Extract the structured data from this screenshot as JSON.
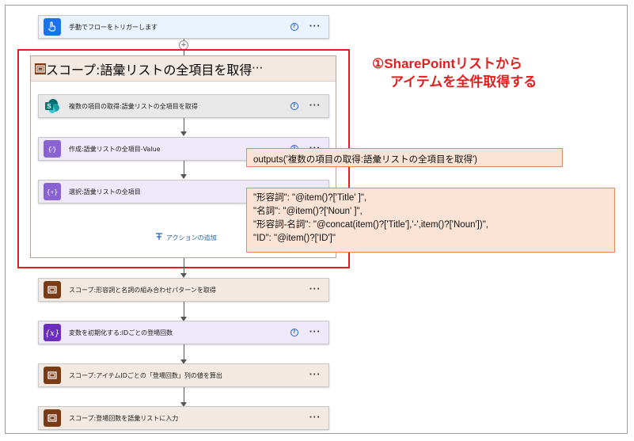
{
  "flow": {
    "trigger": {
      "label": "手動でフローをトリガーします",
      "icon": "hand-touch-icon",
      "color": "#1a73e8"
    },
    "scope_main": {
      "label": "スコープ:語彙リストの全項目を取得",
      "color": "#7a3b17"
    },
    "inner_steps": [
      {
        "label": "複数の項目の取得:語彙リストの全項目を取得",
        "icon": "sharepoint-icon",
        "color": "#038387"
      },
      {
        "label": "作成:語彙リストの全項目-Value",
        "icon": "data-operation-icon",
        "color": "#8a63d2"
      },
      {
        "label": "選択:語彙リストの全項目",
        "icon": "data-operation-icon",
        "color": "#8a63d2"
      }
    ],
    "add_action_label": "アクションの追加",
    "later_steps": [
      {
        "label": "スコープ:形容詞と名詞の組み合わせパターンを取得",
        "type": "scope",
        "has_help": false
      },
      {
        "label": "変数を初期化する:IDごとの登場回数",
        "type": "variable",
        "has_help": true
      },
      {
        "label": "スコープ:アイテムIDごとの「登場回数」列の値を算出",
        "type": "scope",
        "has_help": false
      },
      {
        "label": "スコープ:登場回数を語彙リストに入力",
        "type": "scope",
        "has_help": false
      }
    ],
    "help_glyph": "?",
    "more_glyph": "···",
    "plus_glyph": "+"
  },
  "annotation": {
    "title_line1": "①SharePointリストから",
    "title_line2": "アイテムを全件取得する",
    "compose_expression": "outputs('複数の項目の取得:語彙リストの全項目を取得')",
    "select_mapping": [
      "\"形容詞\": \"@item()?['Title' ]\",",
      "\"名詞\": \"@item()?['Noun' ]\",",
      "\"形容詞-名詞\": \"@concat(item()?['Title'],'-',item()?['Noun'])\",",
      "\"ID\": \"@item()?['ID']\""
    ],
    "accent_color": "#e31e1e",
    "callout_fill": "#fbe3d6"
  }
}
